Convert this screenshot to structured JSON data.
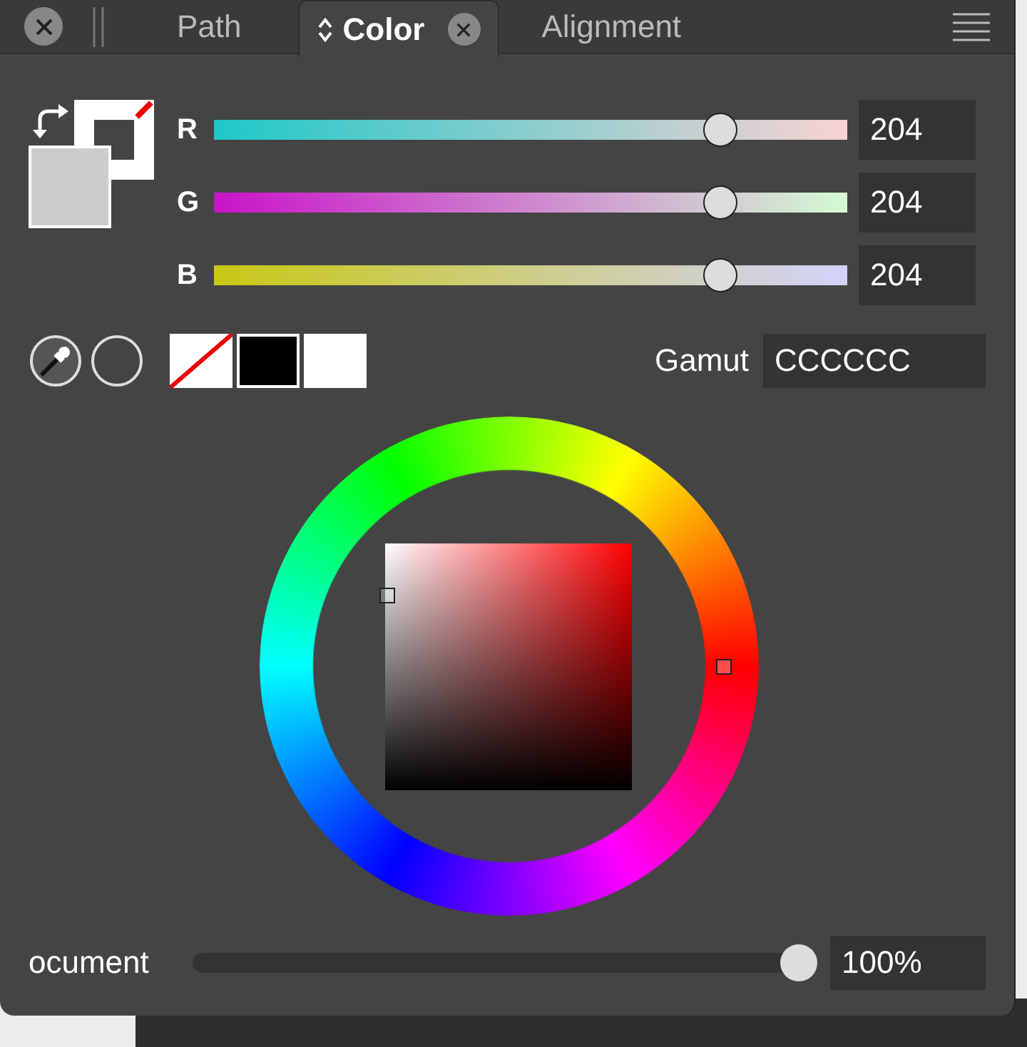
{
  "tabs": [
    {
      "label": "Path",
      "selected": false
    },
    {
      "label": "Color",
      "selected": true
    },
    {
      "label": "Alignment",
      "selected": false
    }
  ],
  "fill": {
    "color": "#cccccc"
  },
  "channels": [
    {
      "name": "R",
      "value": "204",
      "level": 0.8,
      "color": "#1ec8c8"
    },
    {
      "name": "G",
      "value": "204",
      "level": 0.8,
      "color": "#c814c8"
    },
    {
      "name": "B",
      "value": "204",
      "level": 0.8,
      "color": "#c8c814"
    }
  ],
  "swatches": [
    {
      "kind": "none"
    },
    {
      "kind": "solid",
      "color": "#000000"
    },
    {
      "kind": "solid",
      "color": "#ffffff"
    }
  ],
  "hex": {
    "label": "Gamut",
    "value": "CCCCCC"
  },
  "opacity": {
    "label": "ocument",
    "level": 1,
    "value": "100%"
  }
}
